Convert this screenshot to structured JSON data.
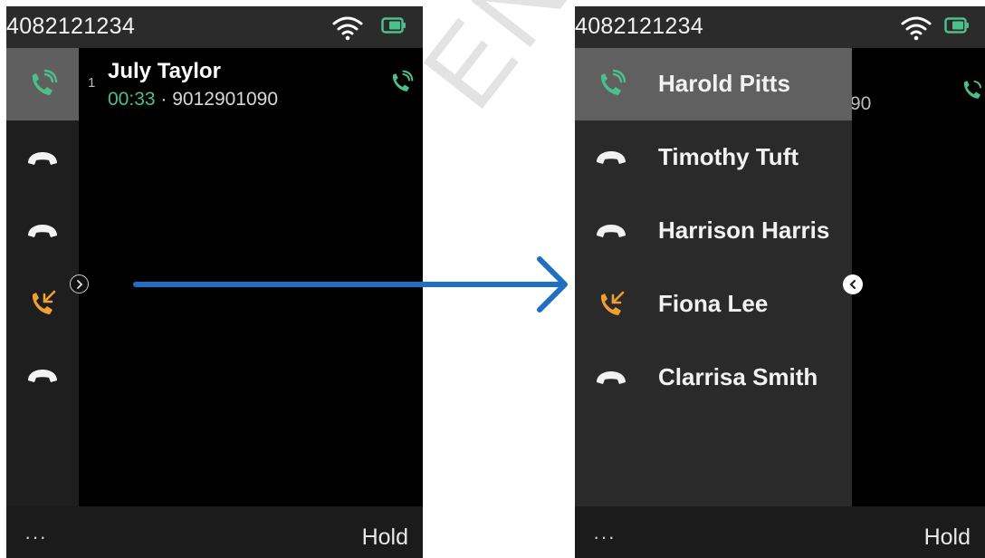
{
  "colors": {
    "accent_green": "#4cbf8c",
    "incoming_orange": "#f0a030",
    "arrow_blue": "#1f6fc4",
    "background_dark": "#000000"
  },
  "watermark": {
    "text": "ENTIA"
  },
  "left_screen": {
    "status_bar": {
      "number": "4082121234",
      "wifi_icon": "wifi-icon",
      "battery_icon": "battery-icon"
    },
    "call_rail": [
      {
        "icon": "active-call-icon",
        "state": "active"
      },
      {
        "icon": "hold-call-icon",
        "state": "held"
      },
      {
        "icon": "hold-call-icon",
        "state": "held"
      },
      {
        "icon": "incoming-call-icon",
        "state": "incoming"
      },
      {
        "icon": "hold-call-icon",
        "state": "held"
      }
    ],
    "active_call": {
      "index": "1",
      "name": "July Taylor",
      "duration": "00:33",
      "separator": " · ",
      "number": "9012901090",
      "icon": "active-call-icon"
    },
    "bottom_bar": {
      "more": "···",
      "softkey": "Hold"
    }
  },
  "right_screen": {
    "status_bar": {
      "number": "4082121234",
      "wifi_icon": "wifi-icon",
      "battery_icon": "battery-icon"
    },
    "call_list": [
      {
        "name": "Harold Pitts",
        "icon": "active-call-icon",
        "state": "active"
      },
      {
        "name": "Timothy Tuft",
        "icon": "hold-call-icon",
        "state": "held"
      },
      {
        "name": "Harrison Harris",
        "icon": "hold-call-icon",
        "state": "held"
      },
      {
        "name": "Fiona Lee",
        "icon": "incoming-call-icon",
        "state": "incoming"
      },
      {
        "name": "Clarrisa Smith",
        "icon": "hold-call-icon",
        "state": "held"
      }
    ],
    "peek_number_fragment": "90",
    "bottom_bar": {
      "more": "···",
      "softkey": "Hold"
    }
  }
}
